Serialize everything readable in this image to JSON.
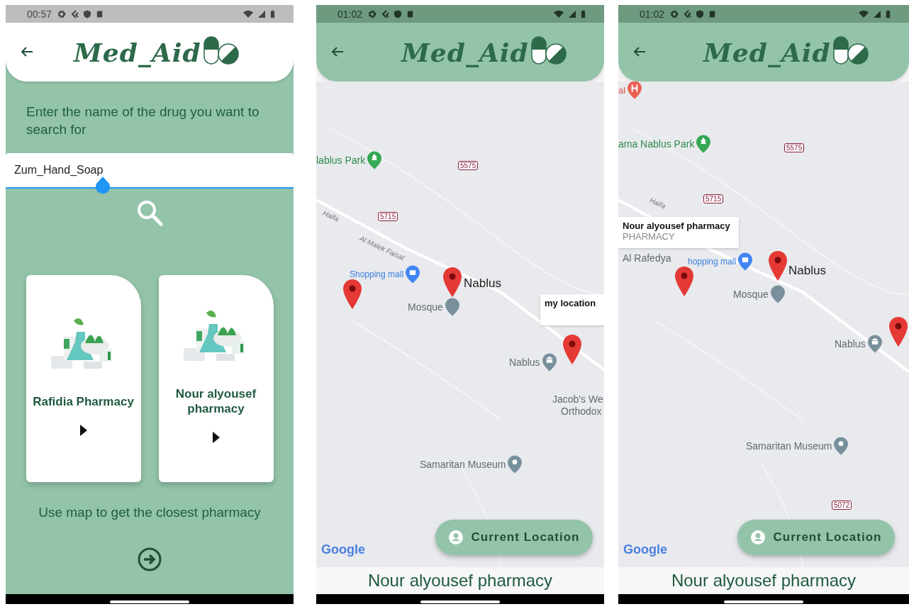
{
  "screens": [
    {
      "kind": "search",
      "status_bar": {
        "time": "00:57"
      },
      "header": {
        "title": "Med_Aid"
      },
      "prompt": "Enter the name of the drug you want to search for",
      "search": {
        "value": "Zum_Hand_Soap"
      },
      "pharmacies": [
        {
          "name": "Rafidia Pharmacy"
        },
        {
          "name": "Nour alyousef pharmacy"
        }
      ],
      "map_hint": "Use map to get the closest pharmacy"
    },
    {
      "kind": "map",
      "status_bar": {
        "time": "01:02"
      },
      "header": {
        "title": "Med_Aid"
      },
      "map_labels": [
        {
          "kind": "park",
          "text": "lablus Park"
        },
        {
          "kind": "shield",
          "text": "5575"
        },
        {
          "kind": "road",
          "text": "Haifa"
        },
        {
          "kind": "shield",
          "text": "5715"
        },
        {
          "kind": "road",
          "text": "Al Malek Faisal"
        },
        {
          "kind": "mall",
          "text": "Shopping mall"
        },
        {
          "kind": "city",
          "text": "Nablus"
        },
        {
          "kind": "mosque",
          "text": "Mosque"
        },
        {
          "kind": "museum",
          "text": "Nablus"
        },
        {
          "kind": "plain",
          "text": "Jacob's We"
        },
        {
          "kind": "plain",
          "text": "Orthodox"
        },
        {
          "kind": "place",
          "text": "Samaritan Museum"
        },
        {
          "kind": "google",
          "text": "Google"
        }
      ],
      "callout": {
        "title": "my location"
      },
      "button": "Current Location",
      "footer": "Nour alyousef pharmacy"
    },
    {
      "kind": "map",
      "status_bar": {
        "time": "01:02"
      },
      "header": {
        "title": "Med_Aid"
      },
      "map_labels": [
        {
          "kind": "hospital",
          "text": "al"
        },
        {
          "kind": "park",
          "text": "ama Nablus Park"
        },
        {
          "kind": "shield",
          "text": "5575"
        },
        {
          "kind": "road",
          "text": "Haifa"
        },
        {
          "kind": "shield",
          "text": "5715"
        },
        {
          "kind": "plain",
          "text": "Al Rafedya"
        },
        {
          "kind": "mall",
          "text": "hopping mall"
        },
        {
          "kind": "city",
          "text": "Nablus"
        },
        {
          "kind": "mosque",
          "text": "Mosque"
        },
        {
          "kind": "museum",
          "text": "Nablus"
        },
        {
          "kind": "place",
          "text": "Samaritan Museum"
        },
        {
          "kind": "shield",
          "text": "5072"
        },
        {
          "kind": "google",
          "text": "Google"
        }
      ],
      "callout": {
        "title": "Nour alyousef pharmacy",
        "subtitle": "PHARMACY"
      },
      "button": "Current Location",
      "footer": "Nour alyousef pharmacy"
    }
  ]
}
